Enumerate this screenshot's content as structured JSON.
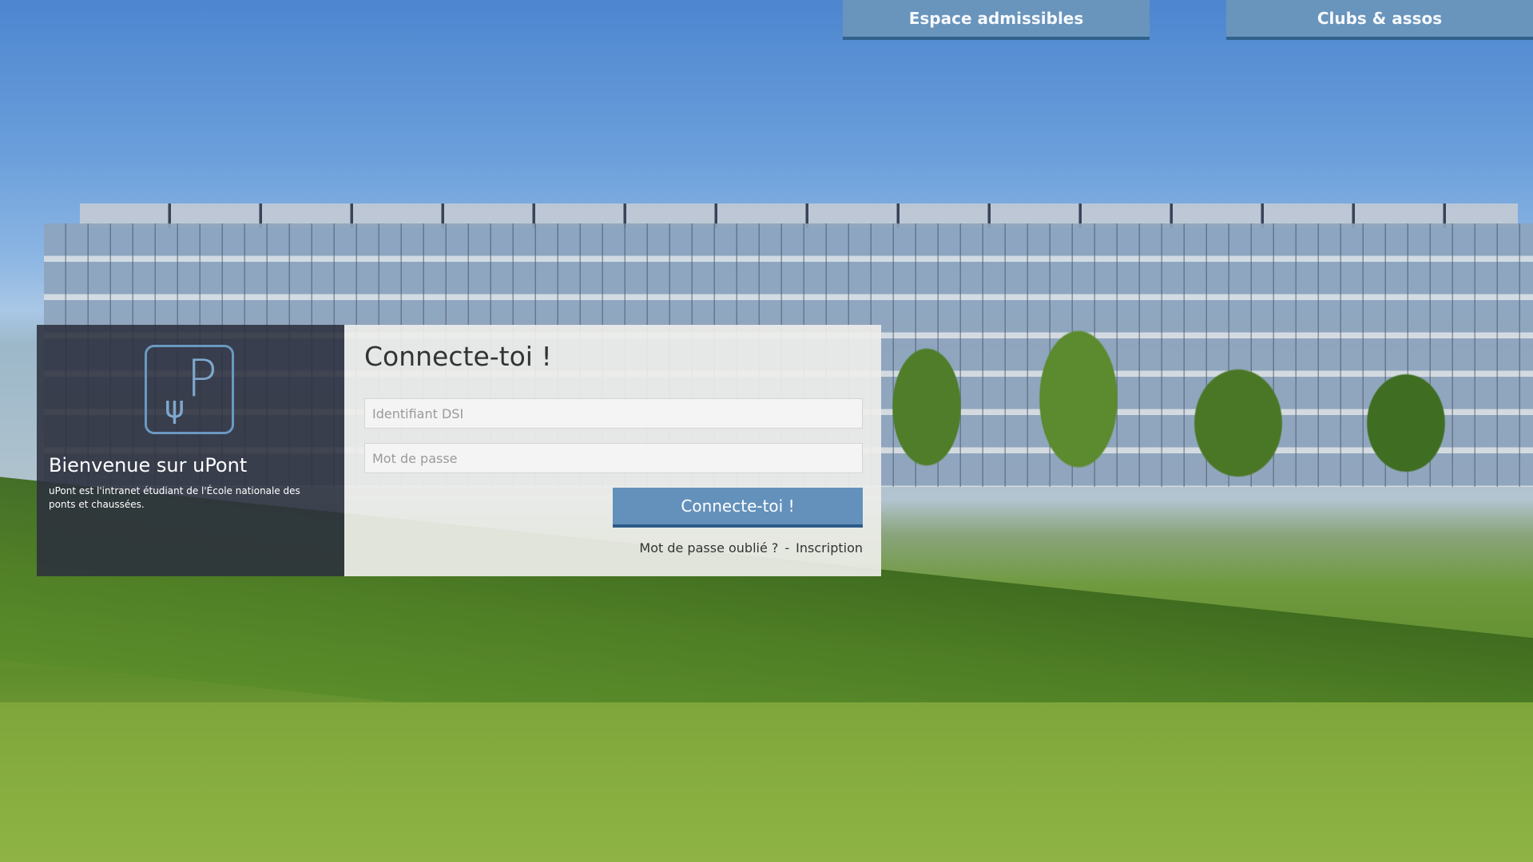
{
  "nav": {
    "admissibles_label": "Espace admissibles",
    "clubs_label": "Clubs & assos"
  },
  "sidebar": {
    "logo_text": "P",
    "logo_mark": "ψ",
    "welcome_title": "Bienvenue sur uPont",
    "welcome_description": "uPont est l'intranet étudiant de l'École nationale des ponts et chaussées."
  },
  "login": {
    "title": "Connecte-toi !",
    "username_placeholder": "Identifiant DSI",
    "password_placeholder": "Mot de passe",
    "submit_label": "Connecte-toi !",
    "forgot_password_label": "Mot de passe oublié ?",
    "separator": "-",
    "register_label": "Inscription"
  },
  "colors": {
    "accent": "#6391bb",
    "accent_dark": "#2d5a87",
    "sidebar_bg": "#2c303e"
  }
}
